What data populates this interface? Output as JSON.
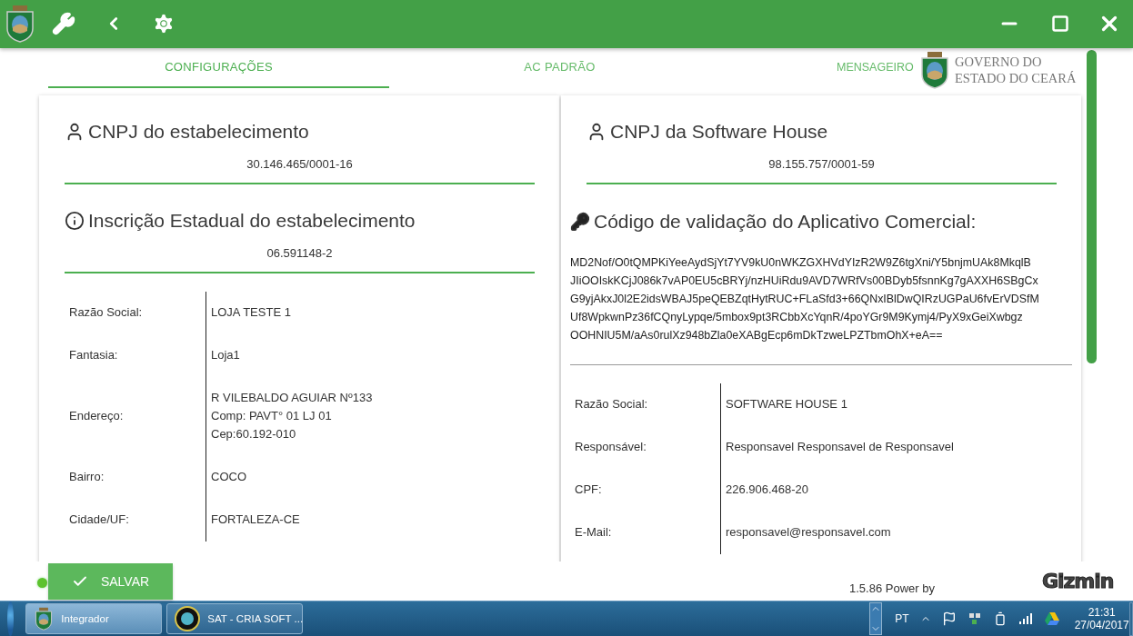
{
  "tabs": [
    {
      "label": "CONFIGURAÇÕES",
      "selected": true
    },
    {
      "label": "AC PADRÃO",
      "selected": false
    },
    {
      "label": "MENSAGEIRO",
      "selected": false
    }
  ],
  "brand": {
    "line_1": "GOVERNO DO",
    "line_2": "ESTADO DO CEARÁ"
  },
  "establishment": {
    "cnpj_title": "CNPJ do estabelecimento",
    "cnpj": "30.146.465/0001-16",
    "ie_title": "Inscrição Estadual do estabelecimento",
    "ie": "06.591148-2",
    "details": [
      {
        "label": "Razão Social:",
        "lines": [
          "LOJA TESTE 1"
        ]
      },
      {
        "label": "Fantasia:",
        "lines": [
          "Loja1"
        ]
      },
      {
        "label": "Endereço:",
        "lines": [
          "R VILEBALDO AGUIAR Nº133",
          "Comp: PAVT° 01 LJ 01",
          "Cep:60.192-010"
        ]
      },
      {
        "label": "Bairro:",
        "lines": [
          "COCO"
        ]
      },
      {
        "label": "Cidade/UF:",
        "lines": [
          "FORTALEZA-CE"
        ]
      }
    ]
  },
  "software_house": {
    "cnpj_title": "CNPJ da Software House",
    "cnpj": "98.155.757/0001-59",
    "code_title": "Código de validação do Aplicativo Comercial:",
    "code_lines": [
      "MD2Nof/O0tQMPKiYeeAydSjYt7YV9kU0nWKZGXHVdYIzR2W9Z6tgXni/Y5bnjmUAk8MkqlB",
      "JIiOOIskKCjJ086k7vAP0EU5cBRYj/nzHUiRdu9AVD7WRfVs00BDyb5fsnnKg7gAXXH6SBgCx",
      "G9yjAkxJ0l2E2idsWBAJ5peQEBZqtHytRUC+FLaSfd3+66QNxIBlDwQIRzUGPaU6fvErVDSfM",
      "Uf8WpkwnPz36fCQnyLypqe/5mbox9pt3RCbbXcYqnR/4poYGr9M9Kymj4/PyX9xGeiXwbgz",
      "OOHNIU5M/aAs0rulXz948bZla0eXABgEcp6mDkTzweLPZTbmOhX+eA=="
    ],
    "details": [
      {
        "label": "Razão Social:",
        "lines": [
          "SOFTWARE HOUSE 1"
        ]
      },
      {
        "label": "Responsável:",
        "lines": [
          "Responsavel Responsavel de Responsavel"
        ]
      },
      {
        "label": "CPF:",
        "lines": [
          "226.906.468-20"
        ]
      },
      {
        "label": "E-Mail:",
        "lines": [
          "responsavel@responsavel.com"
        ]
      }
    ]
  },
  "save_button": {
    "label": "SALVAR"
  },
  "footer": {
    "version": "1.5.86 Power by",
    "logo": "Gizmin"
  },
  "taskbar": {
    "apps": [
      {
        "label": "Integrador",
        "selected": true
      },
      {
        "label": "SAT - CRIA SOFT ...",
        "selected": false
      }
    ],
    "language": "PT",
    "time": "21:31",
    "date": "27/04/2017"
  }
}
